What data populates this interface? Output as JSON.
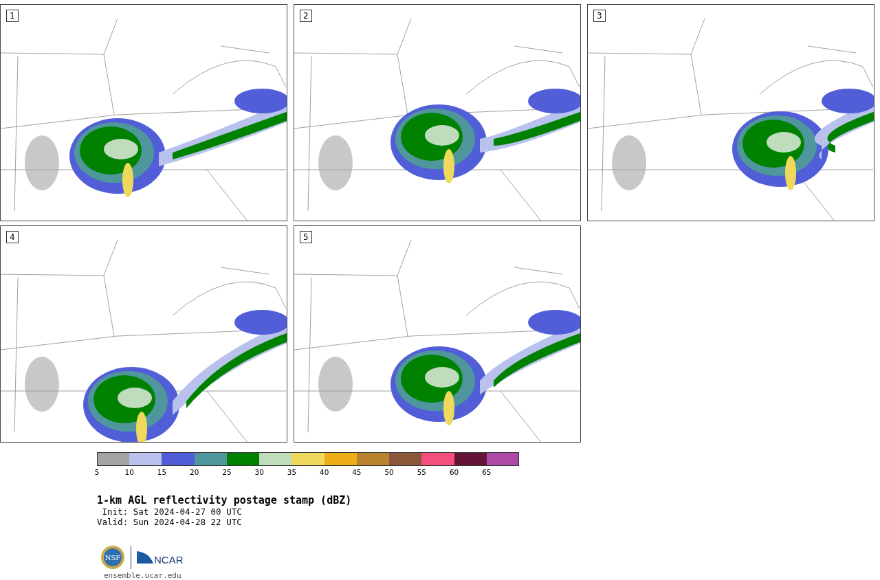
{
  "panels": [
    {
      "label": "1"
    },
    {
      "label": "2"
    },
    {
      "label": "3"
    },
    {
      "label": "4"
    },
    {
      "label": "5"
    }
  ],
  "colorbar": {
    "segments": [
      {
        "tick": "5",
        "color": "#a4a4a4"
      },
      {
        "tick": "10",
        "color": "#b8c2ec"
      },
      {
        "tick": "15",
        "color": "#515ed8"
      },
      {
        "tick": "20",
        "color": "#4f979c"
      },
      {
        "tick": "25",
        "color": "#008200"
      },
      {
        "tick": "30",
        "color": "#bfdcbd"
      },
      {
        "tick": "35",
        "color": "#efd95d"
      },
      {
        "tick": "40",
        "color": "#eeae18"
      },
      {
        "tick": "45",
        "color": "#b9822e"
      },
      {
        "tick": "50",
        "color": "#8b573b"
      },
      {
        "tick": "55",
        "color": "#f44f7e"
      },
      {
        "tick": "60",
        "color": "#641537"
      },
      {
        "tick": "65",
        "color": "#ac4aa6"
      }
    ]
  },
  "title": "1-km AGL reflectivity postage stamp (dBZ)",
  "init": " Init: Sat 2024-04-27 00 UTC",
  "valid": "Valid: Sun 2024-04-28 22 UTC",
  "logos": {
    "nsf": "NSF",
    "ncar": "NCAR"
  },
  "site": "ensemble.ucar.edu"
}
